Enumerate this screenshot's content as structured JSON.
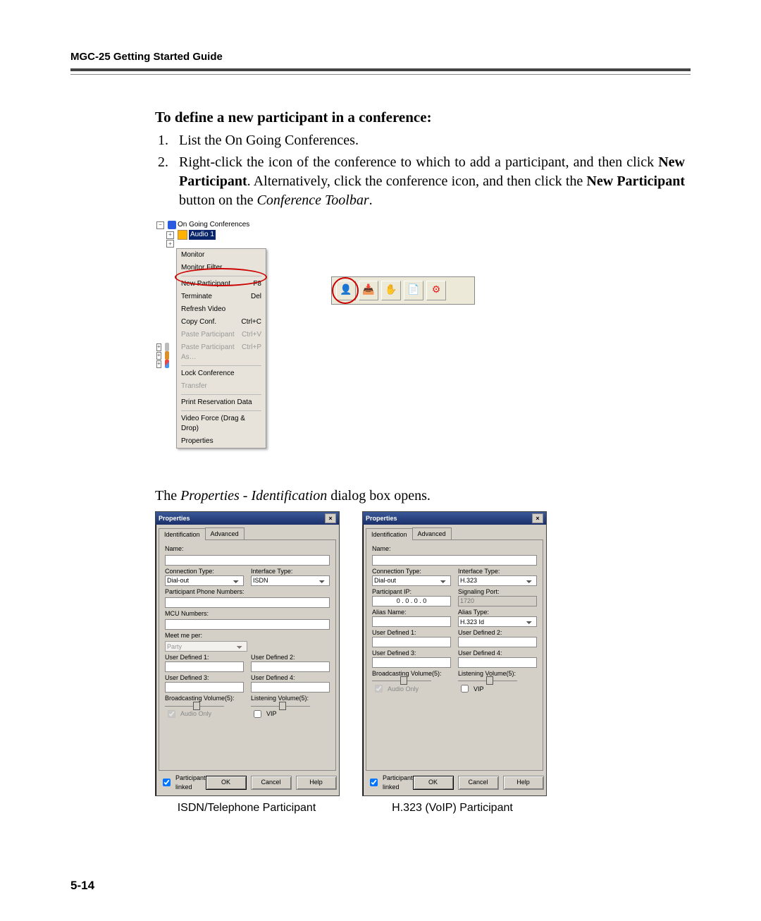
{
  "header": {
    "running_head": "MGC-25 Getting Started Guide"
  },
  "section": {
    "title": "To define a new participant in a conference:",
    "steps": [
      "List the On Going Conferences.",
      "Right-click the icon of the conference to which to add a participant, and then click <b>New Participant</b>. Alternatively, click the conference icon, and then click the <b>New Participant</b> button on the <i>Conference Toolbar</i>."
    ]
  },
  "tree": {
    "root": "On Going Conferences",
    "selected": "Audio 1",
    "context_menu": [
      {
        "label": "Monitor"
      },
      {
        "label": "Monitor Filter..."
      },
      {
        "sep": true
      },
      {
        "label": "New Participant…",
        "shortcut": "F8",
        "highlight": true
      },
      {
        "label": "Terminate",
        "shortcut": "Del",
        "highlight": true
      },
      {
        "label": "Refresh Video"
      },
      {
        "label": "Copy Conf.",
        "shortcut": "Ctrl+C"
      },
      {
        "label": "Paste Participant",
        "shortcut": "Ctrl+V",
        "disabled": true
      },
      {
        "label": "Paste Participant As…",
        "shortcut": "Ctrl+P",
        "disabled": true
      },
      {
        "sep": true
      },
      {
        "label": "Lock Conference"
      },
      {
        "label": "Transfer",
        "disabled": true
      },
      {
        "sep": true
      },
      {
        "label": "Print Reservation Data"
      },
      {
        "sep": true
      },
      {
        "label": "Video Force (Drag & Drop)"
      },
      {
        "label": "Properties"
      }
    ]
  },
  "dialog_opens": "The Properties - Identification dialog box opens.",
  "dialog_common": {
    "title": "Properties",
    "tabs": [
      "Identification",
      "Advanced"
    ],
    "name_label": "Name:",
    "conn_label": "Connection Type:",
    "iface_label": "Interface Type:",
    "ud1": "User Defined 1:",
    "ud2": "User Defined 2:",
    "ud3": "User Defined 3:",
    "ud4": "User Defined 4:",
    "bvol": "Broadcasting Volume(5):",
    "lvol": "Listening Volume(5):",
    "audio_only": "Audio Only",
    "vip": "VIP",
    "linked": "Participant linked",
    "ok": "OK",
    "cancel": "Cancel",
    "help": "Help"
  },
  "isdn_dialog": {
    "conn_value": "Dial-out",
    "iface_value": "ISDN",
    "ppn_label": "Participant Phone Numbers:",
    "mcu_label": "MCU Numbers:",
    "meetme_label": "Meet me per:",
    "meetme_value": "Party"
  },
  "h323_dialog": {
    "conn_value": "Dial-out",
    "iface_value": "H.323",
    "ip_label": "Participant IP:",
    "ip_value": "0 . 0 . 0 . 0",
    "sigport_label": "Signaling Port:",
    "sigport_value": "1720",
    "alias_label": "Alias Name:",
    "atype_label": "Alias Type:",
    "atype_value": "H.323 Id"
  },
  "captions": {
    "left": "ISDN/Telephone Participant",
    "right": "H.323 (VoIP) Participant"
  },
  "footer": {
    "page_number": "5-14"
  }
}
